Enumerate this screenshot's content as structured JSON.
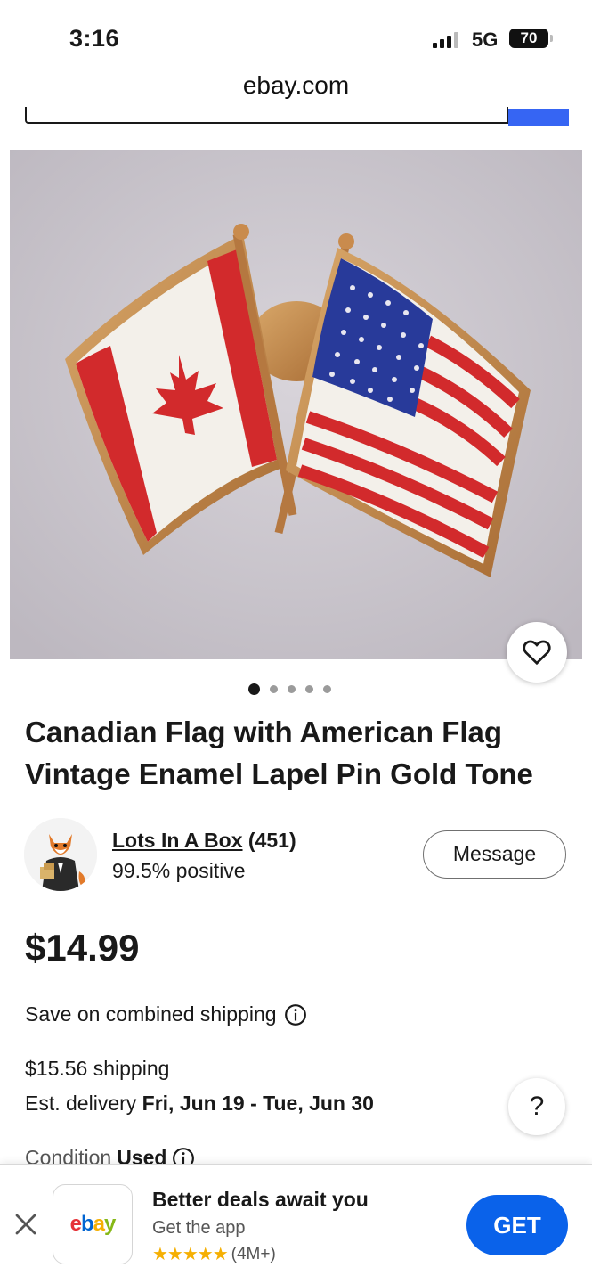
{
  "status_bar": {
    "time": "3:16",
    "network": "5G",
    "battery": "70"
  },
  "browser": {
    "url": "ebay.com"
  },
  "product": {
    "title": "Canadian Flag with American Flag Vintage Enamel Lapel Pin Gold Tone",
    "image_count": 5,
    "active_image": 1
  },
  "seller": {
    "name": "Lots In A Box",
    "feedback_count": "(451)",
    "positive": "99.5% positive",
    "message_label": "Message"
  },
  "price": "$14.99",
  "combined_shipping": "Save on combined shipping",
  "shipping": "$15.56 shipping",
  "delivery": {
    "label": "Est. delivery",
    "dates": "Fri, Jun 19 - Tue, Jun 30"
  },
  "help_label": "?",
  "condition": {
    "label": "Condition",
    "value": "Used"
  },
  "app_banner": {
    "logo_text": "ebay",
    "title": "Better deals await you",
    "subtitle": "Get the app",
    "rating_count": "(4M+)",
    "stars": "★★★★★",
    "get_label": "GET"
  },
  "colors": {
    "ebay_blue": "#3665f3",
    "get_button": "#0a62ea",
    "star": "#f5af02",
    "logo_e": "#e53238",
    "logo_b": "#0064d2",
    "logo_a": "#f5af02",
    "logo_y": "#86b817"
  },
  "icons": [
    "heart-icon",
    "info-icon",
    "close-icon",
    "question-icon"
  ]
}
